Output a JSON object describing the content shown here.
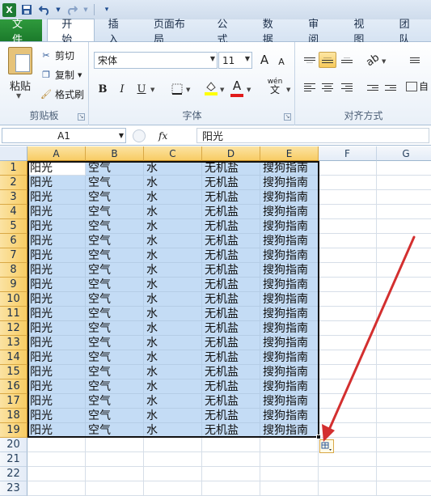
{
  "qat": {
    "app_icon": "X",
    "save_icon": "save-icon",
    "undo_icon": "undo-icon",
    "redo_icon": "redo-icon"
  },
  "tabs": [
    {
      "label": "文件"
    },
    {
      "label": "开始"
    },
    {
      "label": "插入"
    },
    {
      "label": "页面布局"
    },
    {
      "label": "公式"
    },
    {
      "label": "数据"
    },
    {
      "label": "审阅"
    },
    {
      "label": "视图"
    },
    {
      "label": "团队"
    }
  ],
  "ribbon": {
    "clipboard": {
      "paste": "粘贴",
      "cut": "剪切",
      "copy": "复制",
      "format_painter": "格式刷",
      "group_label": "剪贴板"
    },
    "font": {
      "font_name": "宋体",
      "font_size": "11",
      "grow": "A",
      "shrink": "A",
      "bold": "B",
      "italic": "I",
      "underline": "U",
      "font_color": "A",
      "wen": "wén",
      "wen_char": "文",
      "group_label": "字体"
    },
    "alignment": {
      "group_label": "对齐方式",
      "zi": "自"
    }
  },
  "formula_bar": {
    "name_box": "A1",
    "fx": "fx",
    "value": "阳光"
  },
  "grid": {
    "columns": [
      "A",
      "B",
      "C",
      "D",
      "E",
      "F",
      "G"
    ],
    "rows": [
      "1",
      "2",
      "3",
      "4",
      "5",
      "6",
      "7",
      "8",
      "9",
      "10",
      "11",
      "12",
      "13",
      "14",
      "15",
      "16",
      "17",
      "18",
      "19",
      "20",
      "21",
      "22",
      "23"
    ],
    "row_values": [
      "阳光",
      "空气",
      "水",
      "无机盐",
      "搜狗指南"
    ]
  },
  "colors": {
    "selection_fill": "#c4dcf5",
    "header_selected": "#f8cc64",
    "arrow": "#d32f2f",
    "file_tab": "#1b7a2b"
  }
}
